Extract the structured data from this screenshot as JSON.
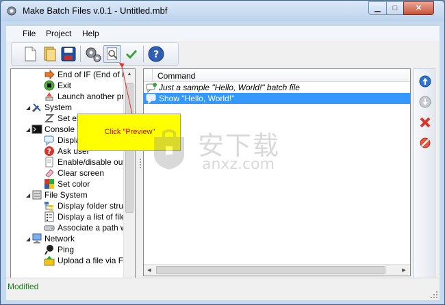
{
  "window": {
    "title": "Make Batch Files v.0.1 - Untitled.mbf",
    "min_glyph": "▁",
    "max_glyph": "□",
    "close_glyph": "✕"
  },
  "menu": [
    "File",
    "Project",
    "Help"
  ],
  "toolbar": {
    "icons": [
      "new-file-icon",
      "open-file-icon",
      "save-icon",
      "settings-icon",
      "preview-icon",
      "check-icon",
      "help-icon"
    ]
  },
  "tree": {
    "items": [
      {
        "label": "End of IF (End of EL",
        "icon": "arrow-right-icon",
        "level": 2
      },
      {
        "label": "Exit",
        "icon": "exit-icon",
        "level": 2
      },
      {
        "label": "Launch another proc",
        "icon": "launch-icon",
        "level": 2
      },
      {
        "label": "System",
        "icon": "tools-icon",
        "level": 1
      },
      {
        "label": "Set exit",
        "icon": "set-exit-icon",
        "level": 2
      },
      {
        "label": "Console",
        "icon": "console-icon",
        "level": 1
      },
      {
        "label": "Display",
        "icon": "speech-icon",
        "level": 2
      },
      {
        "label": "Ask user",
        "icon": "question-icon",
        "level": 2
      },
      {
        "label": "Enable/disable outpu",
        "icon": "toggle-output-icon",
        "level": 2
      },
      {
        "label": "Clear screen",
        "icon": "eraser-icon",
        "level": 2
      },
      {
        "label": "Set color",
        "icon": "palette-icon",
        "level": 2
      },
      {
        "label": "File System",
        "icon": "filesystem-icon",
        "level": 1
      },
      {
        "label": "Display folder struct",
        "icon": "folder-tree-icon",
        "level": 2
      },
      {
        "label": "Display a list of files",
        "icon": "file-list-icon",
        "level": 2
      },
      {
        "label": "Associate a path wit",
        "icon": "drive-icon",
        "level": 2
      },
      {
        "label": "Network",
        "icon": "network-icon",
        "level": 1
      },
      {
        "label": "Ping",
        "icon": "ping-icon",
        "level": 2
      },
      {
        "label": "Upload a file via FTP",
        "icon": "upload-icon",
        "level": 2
      }
    ]
  },
  "commands": {
    "header": "Command",
    "rows": [
      {
        "label": "Just a sample \"Hello, World!\" batch file",
        "style": "italic",
        "selected": false
      },
      {
        "label": "Show \"Hello, World!\"",
        "style": "normal",
        "selected": true
      }
    ]
  },
  "side_toolbar": {
    "icons": [
      "move-up-icon",
      "move-down-icon",
      "delete-icon",
      "clear-all-icon"
    ]
  },
  "callout": {
    "text": "Click \"Preview\""
  },
  "status": {
    "text": "Modified"
  },
  "watermark": {
    "text": "安下载",
    "sub": "anxz.com"
  },
  "colors": {
    "selection": "#3399ff",
    "status_text": "#1a7d1a",
    "callout_bg": "#ffff00",
    "callout_text": "#cc0000"
  }
}
